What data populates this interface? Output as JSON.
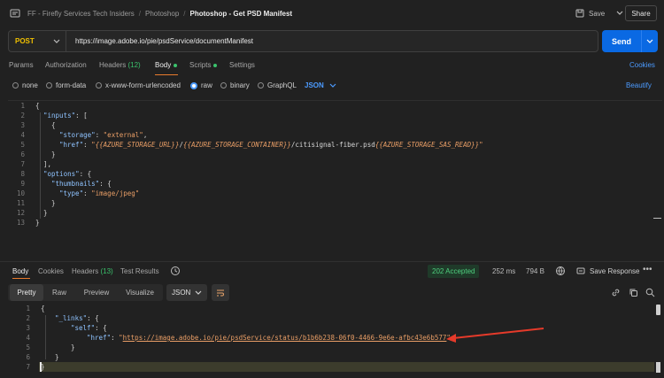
{
  "header": {
    "breadcrumb": [
      "FF - Firefly Services Tech Insiders",
      "Photoshop"
    ],
    "title": "Photoshop - Get PSD Manifest",
    "save_label": "Save",
    "share_label": "Share"
  },
  "request": {
    "method": "POST",
    "url": "https://image.adobe.io/pie/psdService/documentManifest",
    "send_label": "Send"
  },
  "request_tabs": {
    "params": "Params",
    "authorization": "Authorization",
    "headers": "Headers",
    "headers_count": "(12)",
    "body": "Body",
    "scripts": "Scripts",
    "settings": "Settings",
    "cookies": "Cookies",
    "active": "Body"
  },
  "body_types": {
    "none": "none",
    "form_data": "form-data",
    "urlencoded": "x-www-form-urlencoded",
    "raw": "raw",
    "binary": "binary",
    "graphql": "GraphQL",
    "selected": "raw",
    "language": "JSON",
    "beautify": "Beautify"
  },
  "editor": {
    "line_numbers": [
      "1",
      "2",
      "3",
      "4",
      "5",
      "6",
      "7",
      "8",
      "9",
      "10",
      "11",
      "12",
      "13"
    ],
    "lines": {
      "l1": "{",
      "l2_key": "\"inputs\"",
      "l2_rest": ": [",
      "l3": "{",
      "l4_key": "\"storage\"",
      "l4_sep": ": ",
      "l4_val": "\"external\"",
      "l4_end": ",",
      "l5_key": "\"href\"",
      "l5_sep": ": ",
      "l5_q1": "\"",
      "l5_var1": "{{AZURE_STORAGE_URL}}",
      "l5_slash1": "/",
      "l5_var2": "{{AZURE_STORAGE_CONTAINER}}",
      "l5_path": "/citisignal-fiber.psd",
      "l5_var3": "{{AZURE_STORAGE_SAS_READ}}",
      "l5_q2": "\"",
      "l6": "}",
      "l7": "],",
      "l8_key": "\"options\"",
      "l8_rest": ": {",
      "l9_key": "\"thumbnails\"",
      "l9_rest": ": {",
      "l10_key": "\"type\"",
      "l10_sep": ": ",
      "l10_val": "\"image/jpeg\"",
      "l11": "}",
      "l12": "}",
      "l13": "}"
    }
  },
  "response_tabs": {
    "body": "Body",
    "cookies": "Cookies",
    "headers": "Headers",
    "headers_count": "(13)",
    "test_results": "Test Results",
    "status": "202 Accepted",
    "time": "252 ms",
    "size": "794 B",
    "save_response": "Save Response"
  },
  "response_toolbar": {
    "views": [
      "Pretty",
      "Raw",
      "Preview",
      "Visualize"
    ],
    "active_view": "Pretty",
    "format": "JSON"
  },
  "response_body": {
    "line_numbers": [
      "1",
      "2",
      "3",
      "4",
      "5",
      "6",
      "7"
    ],
    "l1": "{",
    "l2_key": "\"_links\"",
    "l2_rest": ": {",
    "l3_key": "\"self\"",
    "l3_rest": ": {",
    "l4_key": "\"href\"",
    "l4_sep": ": ",
    "l4_q1": "\"",
    "l4_url": "https://image.adobe.io/pie/psdService/status/b1b6b238-06f0-4466-9e6e-afbc43e6b577",
    "l4_q2": "\"",
    "l5": "}",
    "l6": "}",
    "l7": "}"
  },
  "colors": {
    "accent_orange": "#e87b2d",
    "send_blue": "#0a69e3",
    "status_green": "#4fd07f",
    "annotation_red": "#e53a2a"
  },
  "icons": [
    "collection-icon",
    "save-icon",
    "chevron-down-icon",
    "history-icon",
    "globe-icon",
    "save-response-icon",
    "link-icon",
    "copy-icon",
    "search-icon",
    "wrap-icon"
  ]
}
